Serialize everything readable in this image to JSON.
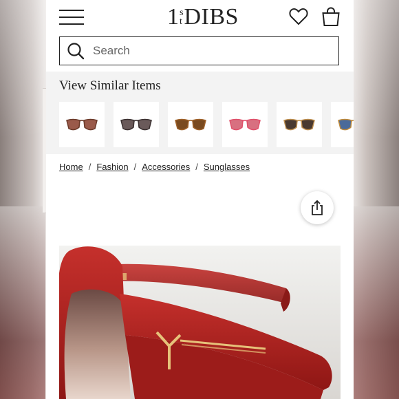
{
  "header": {
    "logo_one": "1",
    "logo_s": "s",
    "logo_t": "t",
    "logo_dibs": "DIBS"
  },
  "search": {
    "placeholder": "Search"
  },
  "similar": {
    "title": "View Similar Items",
    "items": [
      {
        "icon": "sunglasses-thumbnail",
        "lens_color": "#9a5a4a",
        "frame_color": "#6b3a2a"
      },
      {
        "icon": "sunglasses-thumbnail",
        "lens_color": "#6a5a5a",
        "frame_color": "#3a3030"
      },
      {
        "icon": "sunglasses-thumbnail",
        "lens_color": "#7a4a1f",
        "frame_color": "#a0622a"
      },
      {
        "icon": "sunglasses-thumbnail",
        "lens_color": "#d87080",
        "frame_color": "#e0506a"
      },
      {
        "icon": "sunglasses-thumbnail",
        "lens_color": "#4a3a30",
        "frame_color": "#c09050"
      },
      {
        "icon": "sunglasses-thumbnail",
        "lens_color": "#4a6a9a",
        "frame_color": "#c08a3a"
      }
    ]
  },
  "breadcrumb": {
    "items": [
      "Home",
      "Fashion",
      "Accessories",
      "Sunglasses"
    ],
    "separator": "/"
  },
  "colors": {
    "frame_red": "#a51e1c",
    "gold_logo": "#e6c27a"
  }
}
